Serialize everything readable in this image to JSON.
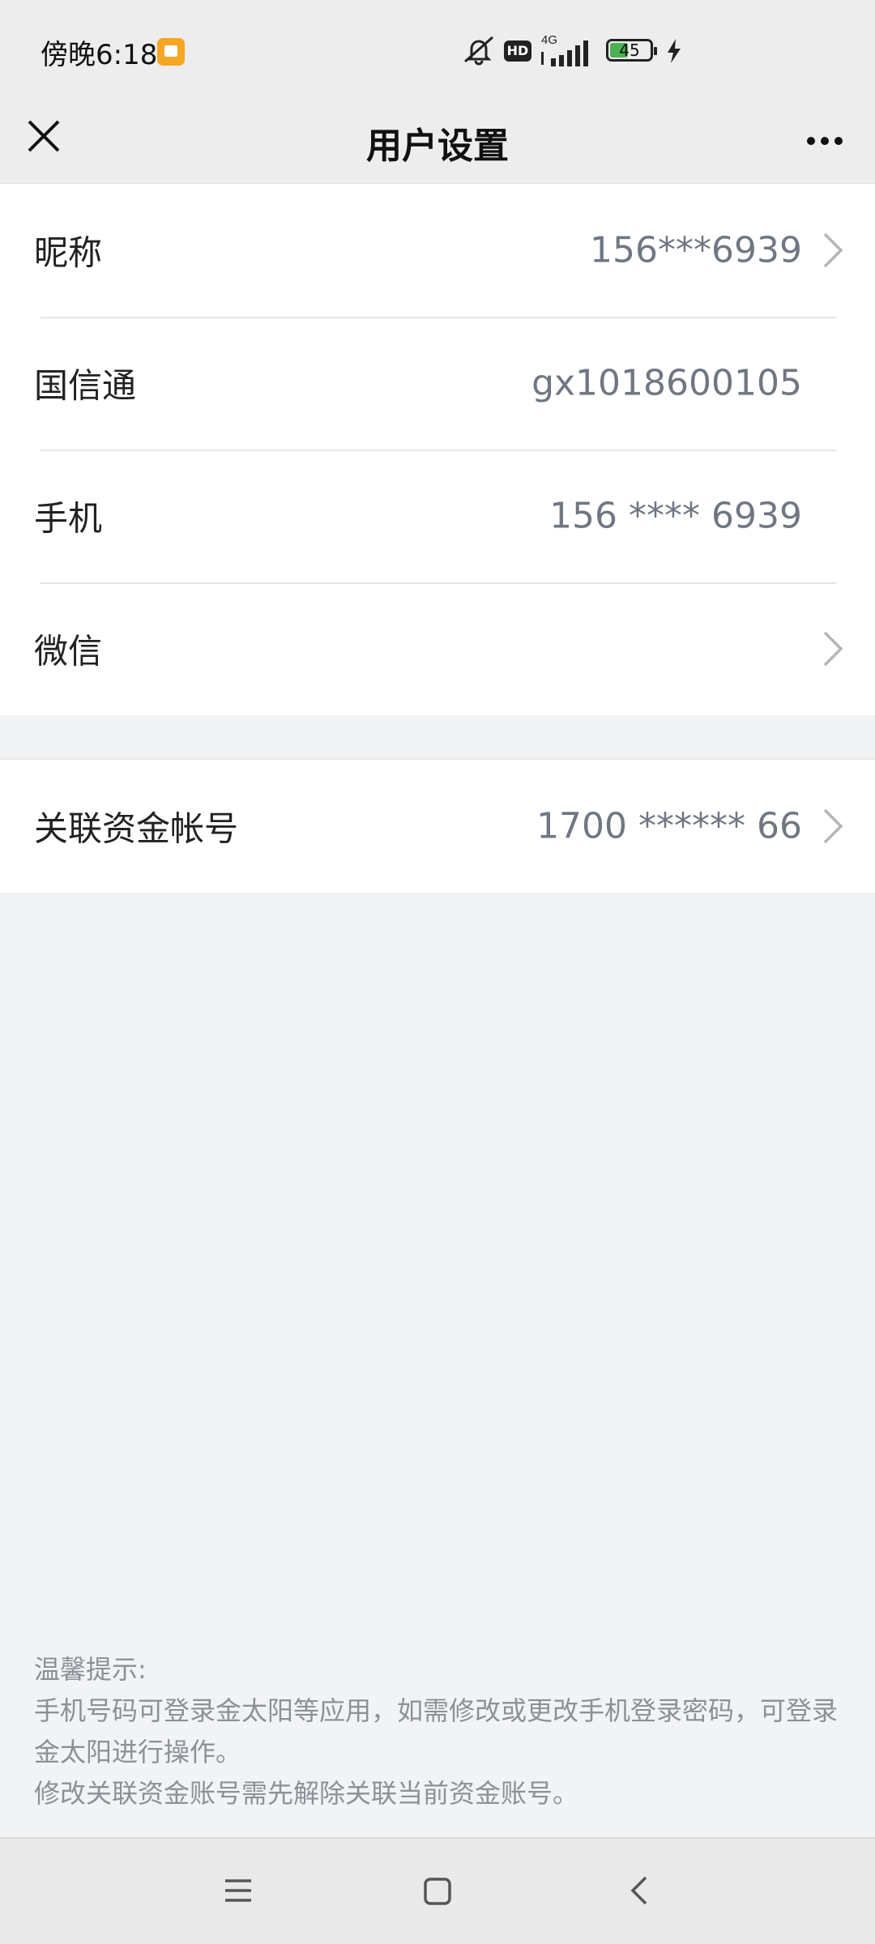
{
  "status_bar": {
    "time": "傍晚6:18",
    "battery": "45",
    "network": "4G",
    "hd": "HD",
    "icons": [
      "notification-icon",
      "mute-icon",
      "hd-icon",
      "signal-icon",
      "battery-icon",
      "charging-icon"
    ]
  },
  "header": {
    "title": "用户设置",
    "close_icon": "close-icon",
    "more_icon": "more-icon"
  },
  "settings": [
    {
      "label": "昵称",
      "value": "156***6939",
      "chevron": true
    },
    {
      "label": "国信通",
      "value": "gx1018600105",
      "chevron": false
    },
    {
      "label": "手机",
      "value": "156 **** 6939",
      "chevron": false
    },
    {
      "label": "微信",
      "value": "",
      "chevron": true
    }
  ],
  "account": {
    "label": "关联资金帐号",
    "value": "1700 ****** 66",
    "chevron": true
  },
  "tips": {
    "title": "温馨提示:",
    "line1": "手机号码可登录金太阳等应用，如需修改或更改手机登录密码，可登录金太阳进行操作。",
    "line2": "修改关联资金账号需先解除关联当前资金账号。"
  },
  "nav": {
    "icons": [
      "menu-icon",
      "home-icon",
      "back-icon"
    ]
  },
  "colors": {
    "page_bg": "#f2f3f5",
    "header_bg": "#ededed",
    "value_text": "#707783",
    "tip_text": "#8c9097"
  }
}
